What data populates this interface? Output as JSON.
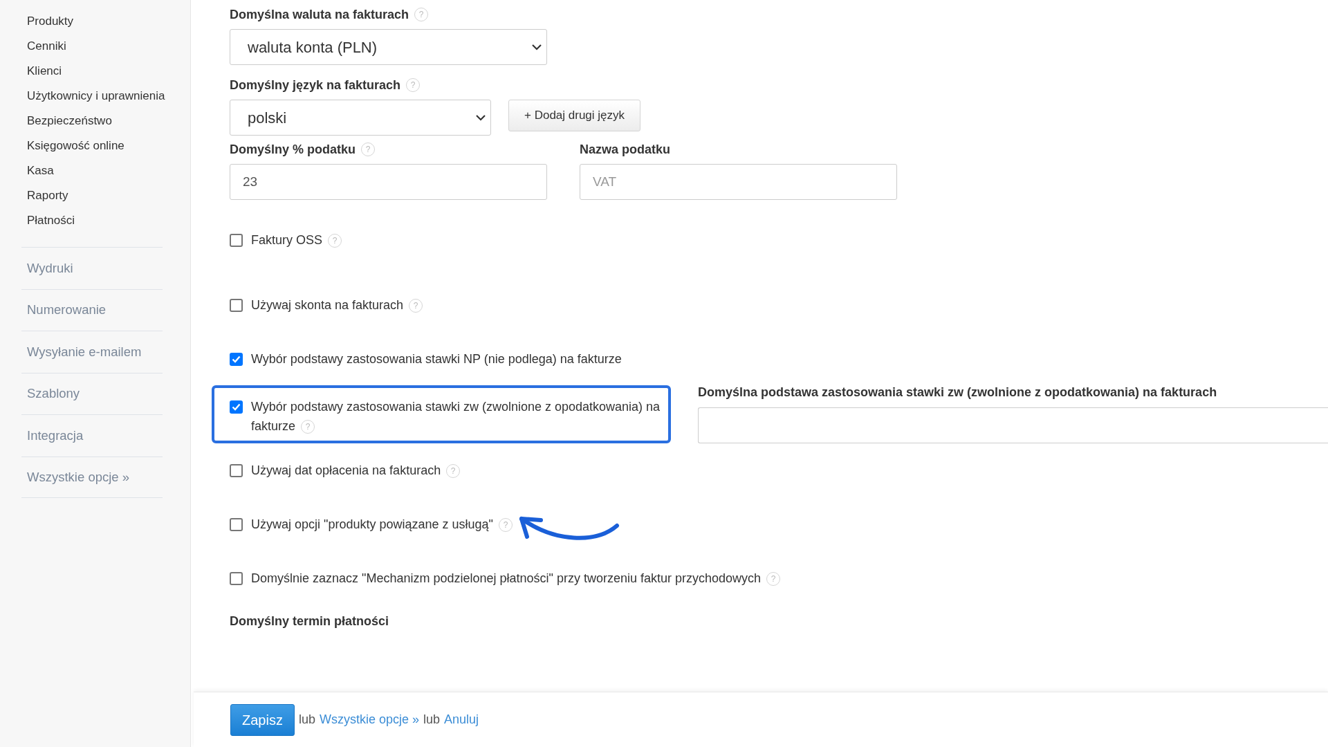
{
  "sidebar": {
    "items": [
      {
        "label": "Produkty"
      },
      {
        "label": "Cenniki"
      },
      {
        "label": "Klienci"
      },
      {
        "label": "Użytkownicy i uprawnienia"
      },
      {
        "label": "Bezpieczeństwo"
      },
      {
        "label": "Księgowość online"
      },
      {
        "label": "Kasa"
      },
      {
        "label": "Raporty"
      },
      {
        "label": "Płatności"
      }
    ],
    "sections": [
      {
        "label": "Wydruki"
      },
      {
        "label": "Numerowanie"
      },
      {
        "label": "Wysyłanie e-mailem"
      },
      {
        "label": "Szablony"
      },
      {
        "label": "Integracja"
      },
      {
        "label": "Wszystkie opcje »"
      }
    ]
  },
  "currency": {
    "label": "Domyślna waluta na fakturach",
    "help": "?",
    "value": "waluta konta (PLN)"
  },
  "language": {
    "label": "Domyślny język na fakturach",
    "help": "?",
    "value": "polski",
    "add_button": "+ Dodaj drugi język"
  },
  "tax_rate": {
    "label": "Domyślny % podatku",
    "help": "?",
    "value": "23"
  },
  "tax_name": {
    "label": "Nazwa podatku",
    "placeholder": "VAT"
  },
  "options": [
    {
      "label": "Faktury OSS",
      "checked": false,
      "help": "?",
      "highlighted": false
    },
    {
      "label": "Używaj skonta na fakturach",
      "checked": false,
      "help": "?",
      "highlighted": false
    },
    {
      "label": "Wybór podstawy zastosowania stawki NP (nie podlega) na fakturze",
      "checked": true,
      "highlighted": false
    },
    {
      "label": "Wybór podstawy zastosowania stawki zw (zwolnione z opodatkowania) na fakturze",
      "checked": true,
      "help": "?",
      "highlighted": true,
      "side_field": {
        "label": "Domyślna podstawa zastosowania stawki zw (zwolnione z opodatkowania) na fakturach"
      }
    },
    {
      "label": "Używaj dat opłacenia na fakturach",
      "checked": false,
      "help": "?",
      "highlighted": false
    },
    {
      "label": "Używaj opcji \"produkty powiązane z usługą\"",
      "checked": false,
      "help": "?",
      "highlighted": false
    },
    {
      "label": "Domyślnie zaznacz \"Mechanizm podzielonej płatności\" przy tworzeniu faktur przychodowych",
      "checked": false,
      "help": "?",
      "highlighted": false
    }
  ],
  "payment_term": {
    "label": "Domyślny termin płatności"
  },
  "footer": {
    "save_button": "Zapisz",
    "separator_1": "lub",
    "all_options_link": "Wszystkie opcje »",
    "separator_2": "lub",
    "cancel_link": "Anuluj"
  }
}
